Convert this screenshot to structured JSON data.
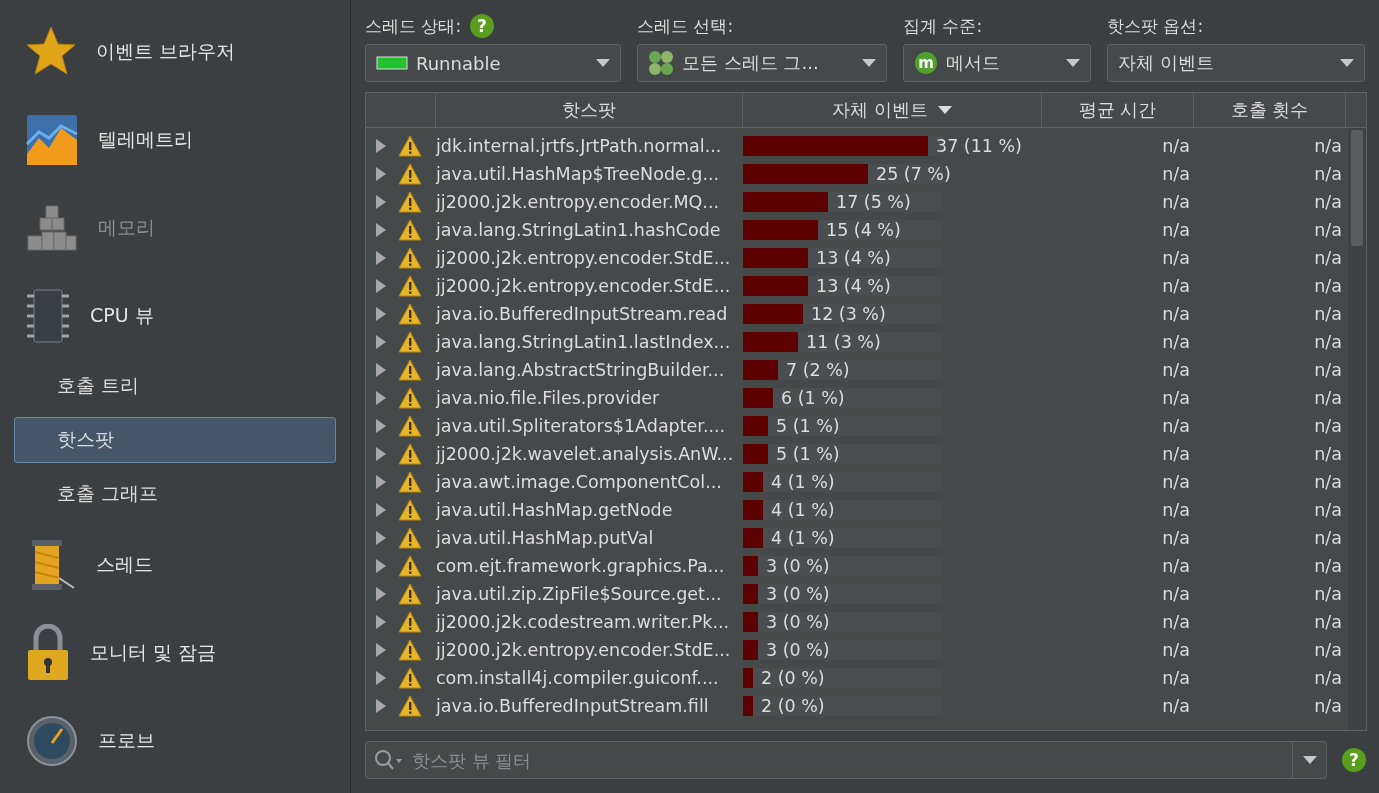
{
  "sidebar": {
    "items": [
      {
        "kind": "section",
        "label": "이벤트 브라우저",
        "disabled": false
      },
      {
        "kind": "section",
        "label": "텔레메트리",
        "disabled": false
      },
      {
        "kind": "section",
        "label": "메모리",
        "disabled": true
      },
      {
        "kind": "section",
        "label": "CPU 뷰",
        "disabled": false
      },
      {
        "kind": "sub",
        "label": "호출 트리",
        "selected": false
      },
      {
        "kind": "sub",
        "label": "핫스팟",
        "selected": true
      },
      {
        "kind": "sub",
        "label": "호출 그래프",
        "selected": false
      },
      {
        "kind": "section",
        "label": "스레드",
        "disabled": false
      },
      {
        "kind": "section",
        "label": "모니터 및 잠금",
        "disabled": false
      },
      {
        "kind": "section",
        "label": "프로브",
        "disabled": false
      }
    ]
  },
  "toolbar": [
    {
      "label": "스레드 상태:",
      "value": "Runnable",
      "help": "?",
      "color": "#22c32e"
    },
    {
      "label": "스레드 선택:",
      "value": "모든 스레드 그..."
    },
    {
      "label": "집계 수준:",
      "value": "메서드",
      "badge": "m"
    },
    {
      "label": "핫스팟 옵션:",
      "value": "자체 이벤트"
    }
  ],
  "table": {
    "columns": [
      {
        "label": "핫스팟",
        "sorted": false
      },
      {
        "label": "자체 이벤트",
        "sorted": true
      },
      {
        "label": "평균 시간",
        "sorted": false
      },
      {
        "label": "호출 횟수",
        "sorted": false
      }
    ],
    "rows": [
      {
        "name": "jdk.internal.jrtfs.JrtPath.normal...",
        "events": "37 (11 %)",
        "level": 0.925,
        "avg": "n/a",
        "count": "n/a"
      },
      {
        "name": "java.util.HashMap$TreeNode.g...",
        "events": "25 (7 %)",
        "level": 0.625,
        "avg": "n/a",
        "count": "n/a"
      },
      {
        "name": "jj2000.j2k.entropy.encoder.MQ...",
        "events": "17 (5 %)",
        "level": 0.425,
        "avg": "n/a",
        "count": "n/a"
      },
      {
        "name": "java.lang.StringLatin1.hashCode",
        "events": "15 (4 %)",
        "level": 0.375,
        "avg": "n/a",
        "count": "n/a"
      },
      {
        "name": "jj2000.j2k.entropy.encoder.StdE...",
        "events": "13 (4 %)",
        "level": 0.325,
        "avg": "n/a",
        "count": "n/a"
      },
      {
        "name": "jj2000.j2k.entropy.encoder.StdE...",
        "events": "13 (4 %)",
        "level": 0.325,
        "avg": "n/a",
        "count": "n/a"
      },
      {
        "name": "java.io.BufferedInputStream.read",
        "events": "12 (3 %)",
        "level": 0.3,
        "avg": "n/a",
        "count": "n/a"
      },
      {
        "name": "java.lang.StringLatin1.lastIndex...",
        "events": "11 (3 %)",
        "level": 0.275,
        "avg": "n/a",
        "count": "n/a"
      },
      {
        "name": "java.lang.AbstractStringBuilder...",
        "events": "7 (2 %)",
        "level": 0.175,
        "avg": "n/a",
        "count": "n/a"
      },
      {
        "name": "java.nio.file.Files.provider",
        "events": "6 (1 %)",
        "level": 0.15,
        "avg": "n/a",
        "count": "n/a"
      },
      {
        "name": "java.util.Spliterators$1Adapter....",
        "events": "5 (1 %)",
        "level": 0.125,
        "avg": "n/a",
        "count": "n/a"
      },
      {
        "name": "jj2000.j2k.wavelet.analysis.AnW...",
        "events": "5 (1 %)",
        "level": 0.125,
        "avg": "n/a",
        "count": "n/a"
      },
      {
        "name": "java.awt.image.ComponentCol...",
        "events": "4 (1 %)",
        "level": 0.1,
        "avg": "n/a",
        "count": "n/a"
      },
      {
        "name": "java.util.HashMap.getNode",
        "events": "4 (1 %)",
        "level": 0.1,
        "avg": "n/a",
        "count": "n/a"
      },
      {
        "name": "java.util.HashMap.putVal",
        "events": "4 (1 %)",
        "level": 0.1,
        "avg": "n/a",
        "count": "n/a"
      },
      {
        "name": "com.ejt.framework.graphics.Pa...",
        "events": "3 (0 %)",
        "level": 0.075,
        "avg": "n/a",
        "count": "n/a"
      },
      {
        "name": "java.util.zip.ZipFile$Source.get...",
        "events": "3 (0 %)",
        "level": 0.075,
        "avg": "n/a",
        "count": "n/a"
      },
      {
        "name": "jj2000.j2k.codestream.writer.Pk...",
        "events": "3 (0 %)",
        "level": 0.075,
        "avg": "n/a",
        "count": "n/a"
      },
      {
        "name": "jj2000.j2k.entropy.encoder.StdE...",
        "events": "3 (0 %)",
        "level": 0.075,
        "avg": "n/a",
        "count": "n/a"
      },
      {
        "name": "com.install4j.compiler.guiconf....",
        "events": "2 (0 %)",
        "level": 0.05,
        "avg": "n/a",
        "count": "n/a"
      },
      {
        "name": "java.io.BufferedInputStream.fill",
        "events": "2 (0 %)",
        "level": 0.05,
        "avg": "n/a",
        "count": "n/a"
      }
    ]
  },
  "filter": {
    "placeholder": "핫스팟 뷰 필터",
    "help": "?"
  }
}
